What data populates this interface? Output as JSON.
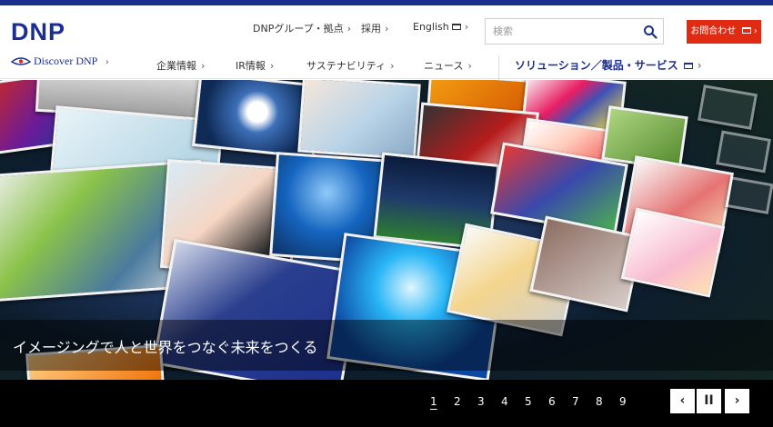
{
  "header": {
    "logo": "DNP",
    "utility": [
      {
        "label": "DNPグループ・拠点",
        "chevron": "›"
      },
      {
        "label": "採用",
        "chevron": "›"
      },
      {
        "label": "English",
        "chevron": "›"
      }
    ],
    "search": {
      "placeholder": "検索",
      "icon": "search-icon"
    },
    "contact_label": "お問合わせ",
    "discover_label": "Discover DNP",
    "discover_chevron": "›",
    "nav": [
      {
        "label": "企業情報",
        "chevron": "›"
      },
      {
        "label": "IR情報",
        "chevron": "›"
      },
      {
        "label": "サステナビリティ",
        "chevron": "›"
      },
      {
        "label": "ニュース",
        "chevron": "›"
      }
    ],
    "solutions_label": "ソリューション／製品・サービス",
    "solutions_chevron": "›"
  },
  "hero": {
    "caption": "イメージングで人と世界をつなぐ未来をつくる"
  },
  "slider": {
    "pages": [
      "1",
      "2",
      "3",
      "4",
      "5",
      "6",
      "7",
      "8",
      "9"
    ],
    "active_page": "1",
    "prev_icon": "chevron-left-icon",
    "pause_icon": "pause-icon",
    "next_icon": "chevron-right-icon",
    "prev_glyph": "‹",
    "pause_glyph": "II",
    "next_glyph": "›"
  },
  "colors": {
    "brand": "#1b2f8e",
    "contact": "#e02a12",
    "footer": "#000000"
  }
}
